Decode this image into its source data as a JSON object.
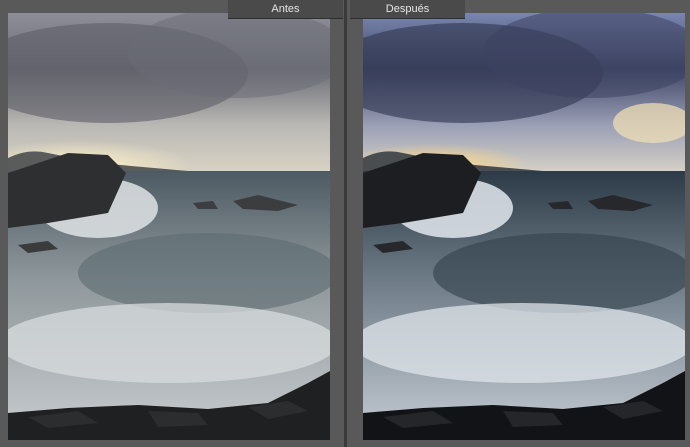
{
  "compare": {
    "before_label": "Antes",
    "after_label": "Después"
  },
  "colors": {
    "background": "#5f5f5f",
    "label_bar": "#4a4a4a",
    "label_text": "#e6e6e6"
  }
}
